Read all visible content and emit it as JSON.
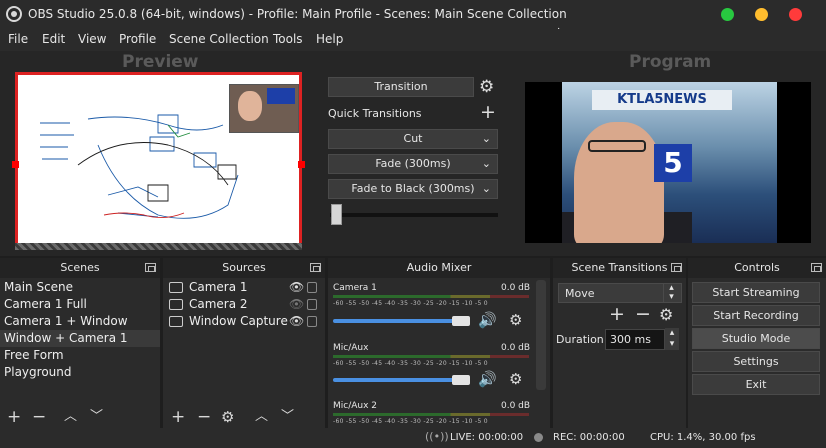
{
  "window": {
    "title": "OBS Studio 25.0.8 (64-bit, windows) - Profile: Main Profile - Scenes: Main Scene Collection",
    "controls": {
      "minimize_color": "#28c840",
      "maximize_color": "#ffbd2e",
      "close_color": "#ff3b3b"
    }
  },
  "menu": [
    "File",
    "Edit",
    "View",
    "Profile",
    "Scene Collection",
    "Tools",
    "Help"
  ],
  "preview": {
    "label": "Preview"
  },
  "program": {
    "label": "Program",
    "image_text_banner": "KTLA5NEWS",
    "image_text_logo": "5"
  },
  "transition_panel": {
    "transition_label": "Transition",
    "quick_transitions_label": "Quick Transitions",
    "quick_items": [
      "Cut",
      "Fade (300ms)",
      "Fade to Black (300ms)"
    ],
    "tbar_level": 0.0
  },
  "scenes": {
    "title": "Scenes",
    "items": [
      "Main Scene",
      "Camera 1 Full",
      "Camera 1 + Window",
      "Window + Camera 1",
      "Free Form",
      "Playground"
    ],
    "selected_index": 3
  },
  "sources": {
    "title": "Sources",
    "items": [
      {
        "label": "Camera 1",
        "visible": true
      },
      {
        "label": "Camera 2",
        "visible": false
      },
      {
        "label": "Window Capture",
        "visible": true
      }
    ]
  },
  "audio_mixer": {
    "title": "Audio Mixer",
    "tick_labels": "-60  -55  -50  -45  -40  -35  -30  -25  -20  -15  -10   -5    0",
    "channels": [
      {
        "name": "Camera 1",
        "db": "0.0 dB",
        "volume": 0.96
      },
      {
        "name": "Mic/Aux",
        "db": "0.0 dB",
        "volume": 0.96
      },
      {
        "name": "Mic/Aux 2",
        "db": "0.0 dB",
        "volume": 0.96
      }
    ]
  },
  "scene_transitions": {
    "title": "Scene Transitions",
    "selected": "Move",
    "duration_label": "Duration",
    "duration_value": "300 ms"
  },
  "controls": {
    "title": "Controls",
    "buttons": [
      "Start Streaming",
      "Start Recording",
      "Studio Mode",
      "Settings",
      "Exit"
    ],
    "active_index": 2
  },
  "status": {
    "live": "LIVE: 00:00:00",
    "rec": "REC: 00:00:00",
    "cpu": "CPU: 1.4%, 30.00 fps"
  },
  "colors": {
    "accent": "#4a90e2",
    "preview_border": "#dd2222",
    "meter_green": "#4fd04f"
  }
}
